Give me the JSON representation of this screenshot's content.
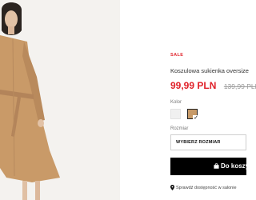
{
  "product": {
    "badge": "SALE",
    "title": "Koszulowa sukienka oversize",
    "price_current": "99,99 PLN",
    "price_old": "139,99 PLN"
  },
  "color": {
    "label": "Kolor",
    "swatches": [
      {
        "name": "white",
        "hex": "#f0f0f0",
        "selected": false
      },
      {
        "name": "camel",
        "hex": "#c79a68",
        "selected": true
      }
    ]
  },
  "size": {
    "label": "Rozmiar",
    "select_value": "WYBIERZ ROZMIAR"
  },
  "cart": {
    "button_label": "Do koszyka",
    "icon": "shopping-bag-icon"
  },
  "availability": {
    "text": "Sprawdź dostępność w salonie",
    "icon": "location-pin-icon"
  },
  "colors": {
    "sale_red": "#e0222a",
    "dress_camel": "#c79a68",
    "button_black": "#000000"
  }
}
